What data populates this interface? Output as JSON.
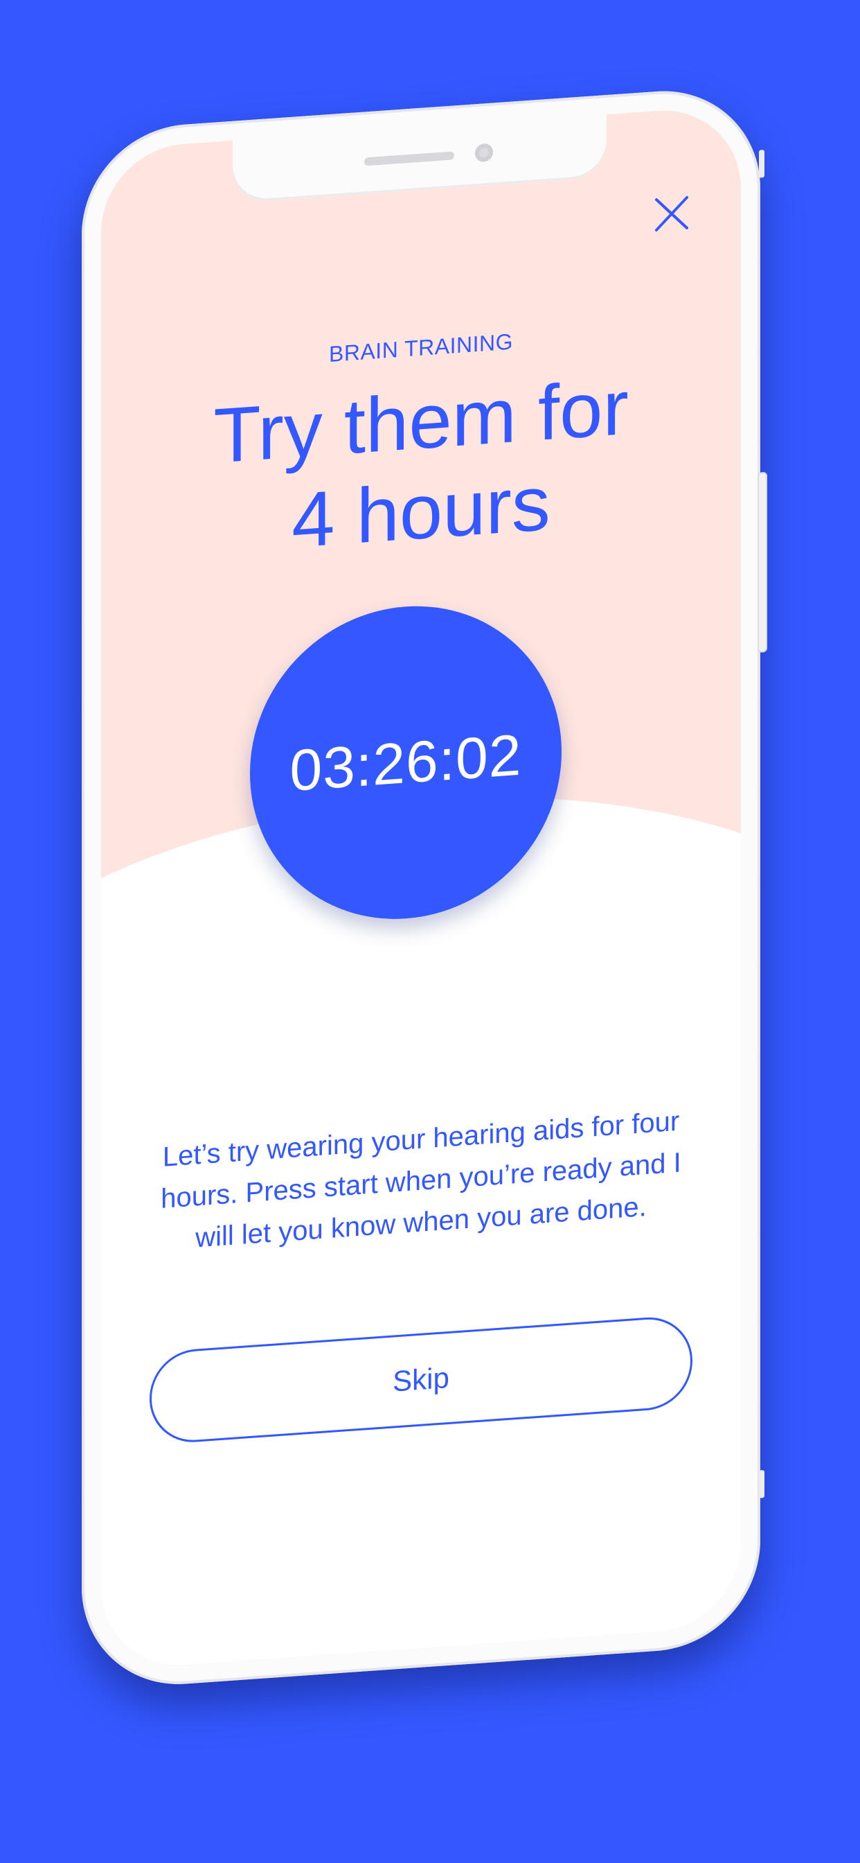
{
  "colors": {
    "background": "#3358ff",
    "accent": "#3358ff",
    "screen_top": "#ffe5e0",
    "screen_bottom": "#ffffff"
  },
  "header": {
    "close_icon": "close-icon"
  },
  "main": {
    "eyebrow": "BRAIN TRAINING",
    "title_line1": "Try them for",
    "title_line2": "4 hours",
    "timer": "03:26:02",
    "message": "Let’s try wearing your hearing aids for four hours. Press start when you’re ready and I will let you know when you are done.",
    "skip_label": "Skip"
  }
}
